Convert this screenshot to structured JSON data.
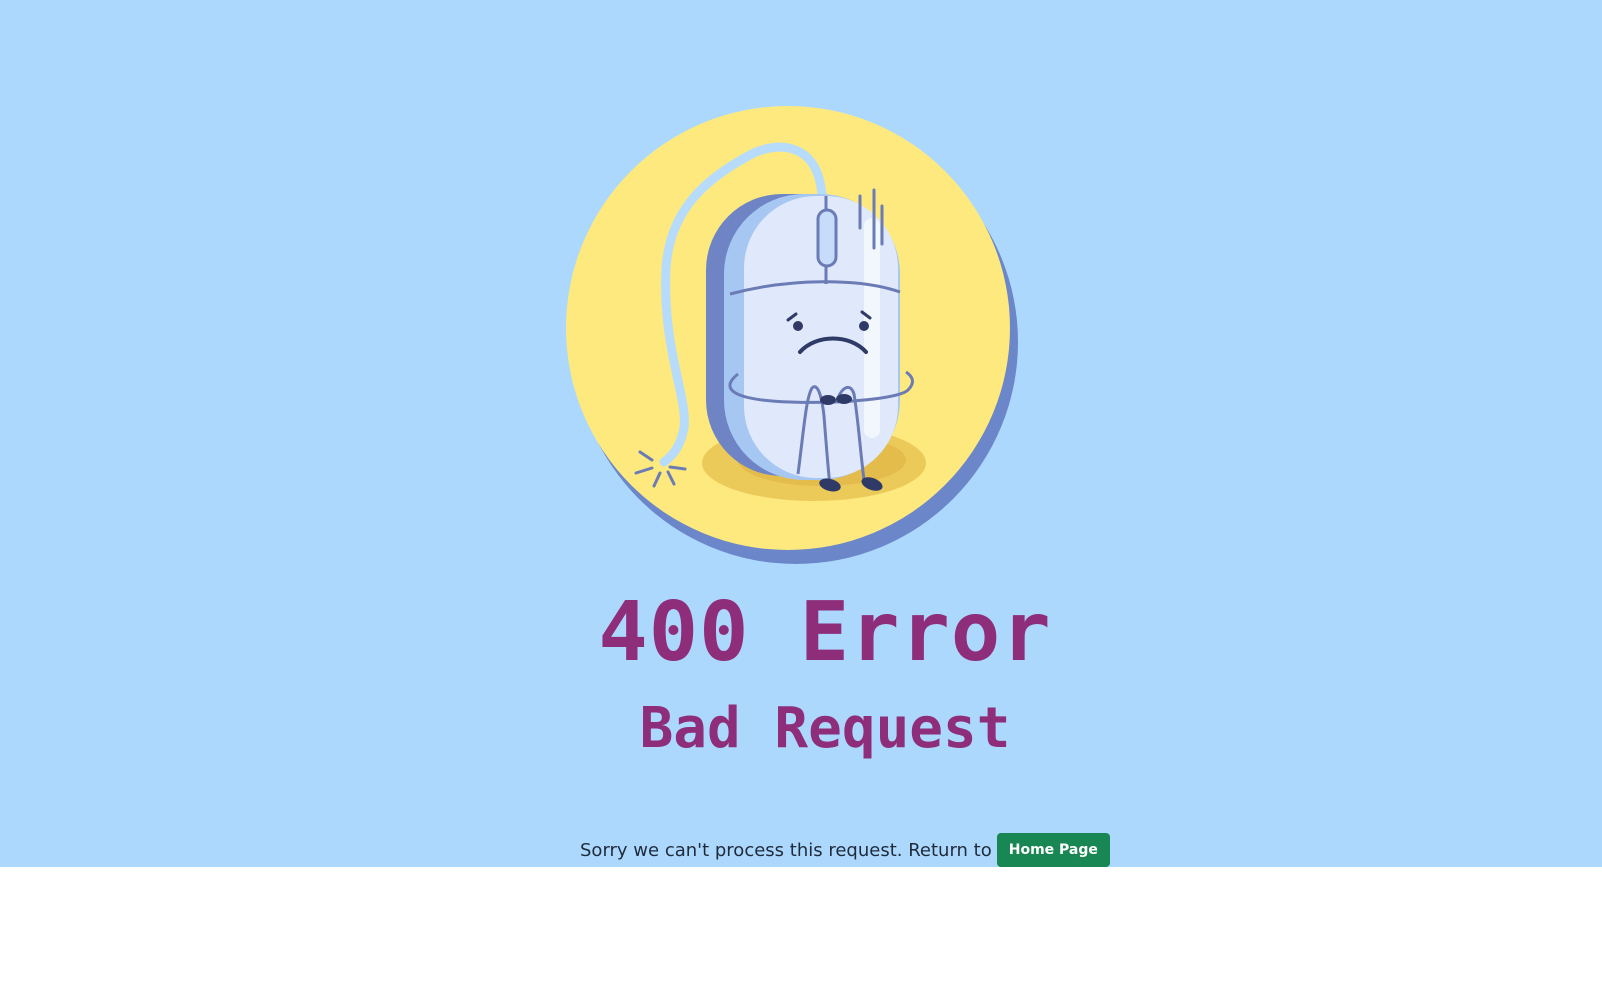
{
  "colors": {
    "hero_background": "#add8fd",
    "heading_color": "#8e2d79",
    "button_background": "#198754",
    "circle_yellow": "#fde97e",
    "circle_shadow": "#6b86c9"
  },
  "illustration": {
    "icon": "sad-mouse-icon"
  },
  "error": {
    "code_text": "400 Error",
    "title": "Bad Request"
  },
  "message": {
    "text": "Sorry we can't process this request. Return to",
    "button_label": "Home Page"
  }
}
